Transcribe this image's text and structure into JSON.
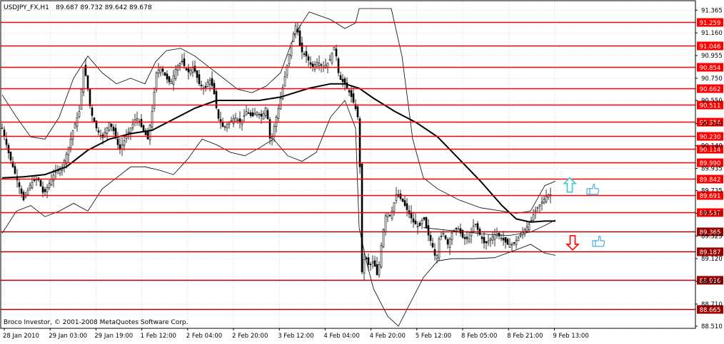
{
  "header": {
    "symbol_tf": "USDJPY_FX,H1",
    "ohlc": "89.687 89.732 89.642 89.678"
  },
  "footer": {
    "copyright": "Broco Investor, © 2001-2008 MetaQuotes Software Corp."
  },
  "colors": {
    "background": "#ffffff",
    "frame": "#000000",
    "grid": "#c0c0c0",
    "candle": "#000000",
    "bollinger": "#000000",
    "moving_average": "#000000",
    "level_line": "#ff0000",
    "level_line_dark": "#b00000",
    "level_label_bg": "#ff0000",
    "level_label_dark_bg": "#9a0000",
    "level_label_text": "#ffffff",
    "up_arrow": "#33cccc",
    "down_arrow": "#ff0000",
    "thumb_icon": "#33aadd"
  },
  "chart_data": {
    "type": "candlestick",
    "symbol": "USDJPY_FX",
    "timeframe": "H1",
    "last_bar": {
      "open": 89.687,
      "high": 89.732,
      "low": 89.642,
      "close": 89.678
    },
    "y_range": [
      88.51,
      91.38
    ],
    "y_ticks": [
      "91.365",
      "91.160",
      "90.955",
      "90.750",
      "90.550",
      "90.340",
      "90.140",
      "89.935",
      "89.735",
      "89.530",
      "89.325",
      "89.120",
      "88.915",
      "88.710",
      "88.510"
    ],
    "x_ticks": [
      "28 Jan 2010",
      "29 Jan 03:00",
      "29 Jan 19:00",
      "1 Feb 12:00",
      "2 Feb 04:00",
      "2 Feb 20:00",
      "3 Feb 12:00",
      "4 Feb 04:00",
      "4 Feb 20:00",
      "5 Feb 12:00",
      "8 Feb 05:00",
      "8 Feb 21:00",
      "9 Feb 13:00"
    ],
    "levels": [
      {
        "value": 91.259,
        "label": "91.259",
        "style": "normal"
      },
      {
        "value": 91.046,
        "label": "91.046",
        "style": "normal"
      },
      {
        "value": 90.854,
        "label": "90.854",
        "style": "normal"
      },
      {
        "value": 90.662,
        "label": "90.662",
        "style": "normal"
      },
      {
        "value": 90.511,
        "label": "90.511",
        "style": "normal"
      },
      {
        "value": 90.354,
        "label": "90.354",
        "style": "normal"
      },
      {
        "value": 90.23,
        "label": "90.230",
        "style": "normal"
      },
      {
        "value": 90.114,
        "label": "90.114",
        "style": "normal"
      },
      {
        "value": 89.99,
        "label": "89.990",
        "style": "normal"
      },
      {
        "value": 89.842,
        "label": "89.842",
        "style": "normal"
      },
      {
        "value": 89.691,
        "label": "89.691",
        "style": "normal"
      },
      {
        "value": 89.537,
        "label": "89.537",
        "style": "normal"
      },
      {
        "value": 89.365,
        "label": "89.365",
        "style": "dark"
      },
      {
        "value": 89.187,
        "label": "89.187",
        "style": "dark"
      },
      {
        "value": 88.926,
        "label": "88.926",
        "style": "dark"
      },
      {
        "value": 88.665,
        "label": "88.665",
        "style": "dark"
      }
    ],
    "price_path": [
      [
        0,
        90.3
      ],
      [
        10,
        90.05
      ],
      [
        20,
        89.85
      ],
      [
        30,
        89.65
      ],
      [
        40,
        89.8
      ],
      [
        50,
        89.85
      ],
      [
        58,
        89.7
      ],
      [
        66,
        89.8
      ],
      [
        74,
        89.9
      ],
      [
        84,
        89.95
      ],
      [
        92,
        90.1
      ],
      [
        100,
        90.3
      ],
      [
        108,
        90.45
      ],
      [
        114,
        90.85
      ],
      [
        118,
        90.75
      ],
      [
        124,
        90.45
      ],
      [
        132,
        90.3
      ],
      [
        140,
        90.2
      ],
      [
        150,
        90.35
      ],
      [
        158,
        90.25
      ],
      [
        164,
        90.1
      ],
      [
        172,
        90.2
      ],
      [
        180,
        90.3
      ],
      [
        188,
        90.4
      ],
      [
        196,
        90.3
      ],
      [
        204,
        90.2
      ],
      [
        210,
        90.45
      ],
      [
        216,
        90.8
      ],
      [
        222,
        90.85
      ],
      [
        230,
        90.75
      ],
      [
        236,
        90.7
      ],
      [
        244,
        90.85
      ],
      [
        252,
        90.9
      ],
      [
        260,
        90.8
      ],
      [
        268,
        90.85
      ],
      [
        276,
        90.7
      ],
      [
        284,
        90.65
      ],
      [
        290,
        90.75
      ],
      [
        296,
        90.65
      ],
      [
        302,
        90.4
      ],
      [
        310,
        90.3
      ],
      [
        318,
        90.35
      ],
      [
        326,
        90.4
      ],
      [
        334,
        90.35
      ],
      [
        342,
        90.45
      ],
      [
        350,
        90.4
      ],
      [
        356,
        90.45
      ],
      [
        364,
        90.4
      ],
      [
        370,
        90.5
      ],
      [
        376,
        90.15
      ],
      [
        382,
        90.35
      ],
      [
        388,
        90.5
      ],
      [
        394,
        90.7
      ],
      [
        400,
        90.9
      ],
      [
        406,
        91.1
      ],
      [
        412,
        91.25
      ],
      [
        418,
        91.0
      ],
      [
        426,
        90.95
      ],
      [
        434,
        90.85
      ],
      [
        442,
        90.9
      ],
      [
        450,
        90.85
      ],
      [
        458,
        90.9
      ],
      [
        466,
        91.05
      ],
      [
        472,
        90.75
      ],
      [
        480,
        90.7
      ],
      [
        488,
        90.6
      ],
      [
        494,
        90.5
      ],
      [
        500,
        90.35
      ],
      [
        502,
        89.55
      ],
      [
        504,
        89.0
      ],
      [
        508,
        89.15
      ],
      [
        514,
        89.05
      ],
      [
        520,
        89.1
      ],
      [
        526,
        88.95
      ],
      [
        532,
        89.3
      ],
      [
        538,
        89.55
      ],
      [
        544,
        89.5
      ],
      [
        552,
        89.7
      ],
      [
        560,
        89.65
      ],
      [
        568,
        89.55
      ],
      [
        576,
        89.45
      ],
      [
        584,
        89.4
      ],
      [
        590,
        89.5
      ],
      [
        596,
        89.35
      ],
      [
        602,
        89.25
      ],
      [
        608,
        89.1
      ],
      [
        612,
        89.3
      ],
      [
        618,
        89.35
      ],
      [
        624,
        89.25
      ],
      [
        630,
        89.35
      ],
      [
        638,
        89.4
      ],
      [
        646,
        89.3
      ],
      [
        654,
        89.3
      ],
      [
        662,
        89.45
      ],
      [
        668,
        89.35
      ],
      [
        676,
        89.25
      ],
      [
        684,
        89.3
      ],
      [
        692,
        89.35
      ],
      [
        700,
        89.3
      ],
      [
        708,
        89.25
      ],
      [
        716,
        89.25
      ],
      [
        722,
        89.3
      ],
      [
        728,
        89.35
      ],
      [
        734,
        89.4
      ],
      [
        740,
        89.45
      ],
      [
        746,
        89.55
      ],
      [
        752,
        89.6
      ],
      [
        758,
        89.65
      ],
      [
        764,
        89.7
      ],
      [
        770,
        89.68
      ]
    ],
    "moving_average": [
      [
        0,
        89.85
      ],
      [
        30,
        89.86
      ],
      [
        60,
        89.88
      ],
      [
        90,
        89.95
      ],
      [
        120,
        90.1
      ],
      [
        150,
        90.2
      ],
      [
        180,
        90.25
      ],
      [
        210,
        90.28
      ],
      [
        240,
        90.38
      ],
      [
        270,
        90.48
      ],
      [
        300,
        90.55
      ],
      [
        330,
        90.55
      ],
      [
        360,
        90.55
      ],
      [
        390,
        90.58
      ],
      [
        410,
        90.62
      ],
      [
        430,
        90.66
      ],
      [
        460,
        90.7
      ],
      [
        480,
        90.7
      ],
      [
        500,
        90.66
      ],
      [
        520,
        90.57
      ],
      [
        550,
        90.45
      ],
      [
        580,
        90.35
      ],
      [
        610,
        90.22
      ],
      [
        640,
        90.02
      ],
      [
        670,
        89.82
      ],
      [
        700,
        89.6
      ],
      [
        720,
        89.48
      ],
      [
        740,
        89.45
      ],
      [
        760,
        89.46
      ],
      [
        775,
        89.46
      ]
    ],
    "bollinger_upper": [
      [
        0,
        90.6
      ],
      [
        20,
        90.4
      ],
      [
        40,
        90.22
      ],
      [
        60,
        90.2
      ],
      [
        80,
        90.4
      ],
      [
        100,
        90.75
      ],
      [
        120,
        90.95
      ],
      [
        140,
        90.8
      ],
      [
        160,
        90.7
      ],
      [
        180,
        90.75
      ],
      [
        200,
        90.7
      ],
      [
        215,
        90.9
      ],
      [
        230,
        91.0
      ],
      [
        250,
        91.02
      ],
      [
        270,
        90.95
      ],
      [
        290,
        90.85
      ],
      [
        310,
        90.75
      ],
      [
        330,
        90.65
      ],
      [
        350,
        90.62
      ],
      [
        370,
        90.68
      ],
      [
        390,
        90.8
      ],
      [
        410,
        91.15
      ],
      [
        430,
        91.35
      ],
      [
        460,
        91.28
      ],
      [
        480,
        91.2
      ],
      [
        495,
        91.25
      ],
      [
        500,
        91.38
      ],
      [
        520,
        91.38
      ],
      [
        540,
        91.38
      ],
      [
        545,
        91.38
      ],
      [
        560,
        90.95
      ],
      [
        575,
        90.2
      ],
      [
        590,
        89.85
      ],
      [
        610,
        89.75
      ],
      [
        640,
        89.65
      ],
      [
        670,
        89.58
      ],
      [
        700,
        89.55
      ],
      [
        720,
        89.53
      ],
      [
        740,
        89.55
      ],
      [
        760,
        89.78
      ],
      [
        775,
        89.82
      ]
    ],
    "bollinger_lower": [
      [
        0,
        89.35
      ],
      [
        20,
        89.55
      ],
      [
        40,
        89.6
      ],
      [
        60,
        89.5
      ],
      [
        80,
        89.55
      ],
      [
        100,
        89.62
      ],
      [
        120,
        89.55
      ],
      [
        140,
        89.75
      ],
      [
        160,
        89.85
      ],
      [
        180,
        89.95
      ],
      [
        200,
        89.95
      ],
      [
        220,
        89.92
      ],
      [
        240,
        89.88
      ],
      [
        260,
        90.02
      ],
      [
        280,
        90.2
      ],
      [
        300,
        90.15
      ],
      [
        320,
        90.08
      ],
      [
        340,
        90.05
      ],
      [
        360,
        90.12
      ],
      [
        380,
        90.2
      ],
      [
        400,
        90.05
      ],
      [
        420,
        90.0
      ],
      [
        440,
        90.08
      ],
      [
        460,
        90.4
      ],
      [
        480,
        90.55
      ],
      [
        495,
        90.3
      ],
      [
        500,
        89.4
      ],
      [
        510,
        89.1
      ],
      [
        520,
        88.85
      ],
      [
        540,
        88.6
      ],
      [
        555,
        88.51
      ],
      [
        570,
        88.7
      ],
      [
        590,
        88.95
      ],
      [
        610,
        89.1
      ],
      [
        630,
        89.12
      ],
      [
        660,
        89.12
      ],
      [
        690,
        89.13
      ],
      [
        720,
        89.2
      ],
      [
        740,
        89.25
      ],
      [
        760,
        89.17
      ],
      [
        775,
        89.15
      ]
    ],
    "bollinger_middle_late": [
      [
        590,
        89.4
      ],
      [
        620,
        89.38
      ],
      [
        650,
        89.36
      ],
      [
        680,
        89.34
      ],
      [
        710,
        89.33
      ],
      [
        740,
        89.36
      ],
      [
        760,
        89.42
      ],
      [
        775,
        89.47
      ]
    ],
    "signals": [
      {
        "type": "up-arrow",
        "price": 89.78,
        "bar": 798
      },
      {
        "type": "thumb-up",
        "price": 89.74,
        "bar": 830
      },
      {
        "type": "down-arrow",
        "price": 89.27,
        "bar": 802
      },
      {
        "type": "thumb-down",
        "price": 89.27,
        "bar": 838
      }
    ]
  }
}
